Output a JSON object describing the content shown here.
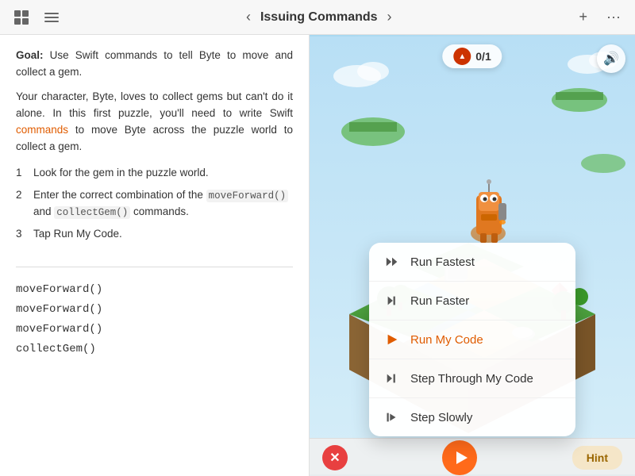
{
  "topBar": {
    "title": "Issuing Commands",
    "prevLabel": "‹",
    "nextLabel": "›",
    "addLabel": "+",
    "moreLabel": "···"
  },
  "leftPanel": {
    "goalLabel": "Goal:",
    "goalText": " Use Swift commands to tell Byte to move and collect a gem.",
    "descriptionText": "Your character, Byte, loves to collect gems but can't do it alone. In this first puzzle, you'll need to write Swift ",
    "commandsWord": "commands",
    "descriptionEnd": " to move Byte across the puzzle world to collect a gem.",
    "steps": [
      {
        "num": "1",
        "text": "Look for the gem in the puzzle world."
      },
      {
        "num": "2",
        "text1": "Enter the correct combination of the ",
        "code1": "moveForward()",
        "text2": " and ",
        "code2": "collectGem()",
        "text3": " commands."
      },
      {
        "num": "3",
        "text": "Tap Run My Code."
      }
    ],
    "codeLines": [
      "moveForward()",
      "moveForward()",
      "moveForward()",
      "collectGem()"
    ]
  },
  "rightPanel": {
    "scoreText": "0/1",
    "soundIcon": "🔊",
    "runMenu": {
      "items": [
        {
          "id": "run-fastest",
          "label": "Run Fastest",
          "iconType": "double-fast"
        },
        {
          "id": "run-faster",
          "label": "Run Faster",
          "iconType": "fast"
        },
        {
          "id": "run-my-code",
          "label": "Run My Code",
          "iconType": "play",
          "highlighted": true
        },
        {
          "id": "step-through",
          "label": "Step Through My Code",
          "iconType": "step"
        },
        {
          "id": "step-slowly",
          "label": "Step Slowly",
          "iconType": "step-slow"
        }
      ]
    },
    "bottomBar": {
      "closeLabel": "✕",
      "hintLabel": "Hint"
    }
  }
}
